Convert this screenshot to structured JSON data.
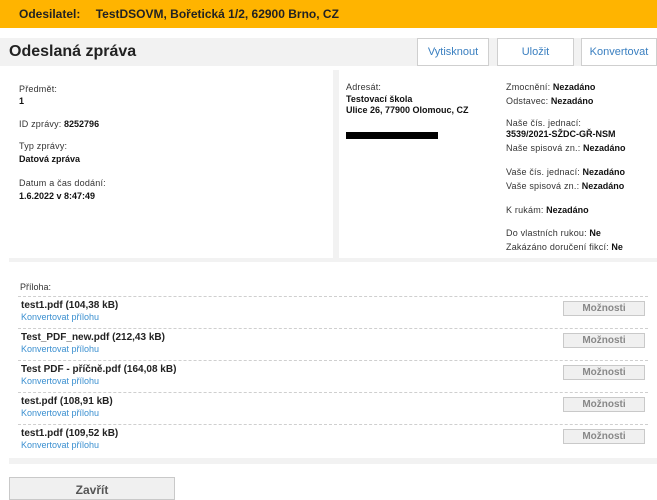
{
  "sender_bar": {
    "label": "Odesilatel:",
    "value": "TestDSOVM, Bořetická 1/2, 62900 Brno, CZ",
    "color": "#ffb400"
  },
  "header": {
    "title": "Odeslaná zpráva",
    "buttons": {
      "print": "Vytisknout",
      "save": "Uložit",
      "convert": "Konvertovat"
    }
  },
  "message": {
    "subject_label": "Předmět:",
    "subject_value": "1",
    "id_label": "ID zprávy:",
    "id_value": "8252796",
    "type_label": "Typ zprávy:",
    "type_value": "Datová zpráva",
    "delivery_label": "Datum a čas dodání:",
    "delivery_value": "1.6.2022 v 8:47:49"
  },
  "recipient": {
    "label": "Adresát:",
    "name": "Testovací škola",
    "address": "Ulice 26, 77900 Olomouc, CZ"
  },
  "meta": {
    "authorization_label": "Zmocnění:",
    "authorization_value": "Nezadáno",
    "paragraph_label": "Odstavec:",
    "paragraph_value": "Nezadáno",
    "our_ref_label": "Naše čís. jednací:",
    "our_ref_value": "3539/2021-SŽDC-GŘ-NSM",
    "our_file_label": "Naše spisová zn.:",
    "our_file_value": "Nezadáno",
    "your_ref_label": "Vaše čís. jednací:",
    "your_ref_value": "Nezadáno",
    "your_file_label": "Vaše spisová zn.:",
    "your_file_value": "Nezadáno",
    "to_hands_label": "K rukám:",
    "to_hands_value": "Nezadáno",
    "own_hands_label": "Do vlastních rukou:",
    "own_hands_value": "Ne",
    "fiction_label": "Zakázáno doručení fikcí:",
    "fiction_value": "Ne"
  },
  "attachments": {
    "title": "Příloha:",
    "convert_label": "Konvertovat přílohu",
    "options_label": "Možnosti",
    "items": [
      {
        "name": "test1.pdf (104,38 kB)"
      },
      {
        "name": "Test_PDF_new.pdf (212,43 kB)"
      },
      {
        "name": "Test PDF - příčně.pdf (164,08 kB)"
      },
      {
        "name": "test.pdf (108,91 kB)"
      },
      {
        "name": "test1.pdf (109,52 kB)"
      }
    ]
  },
  "footer": {
    "close_label": "Zavřít"
  }
}
